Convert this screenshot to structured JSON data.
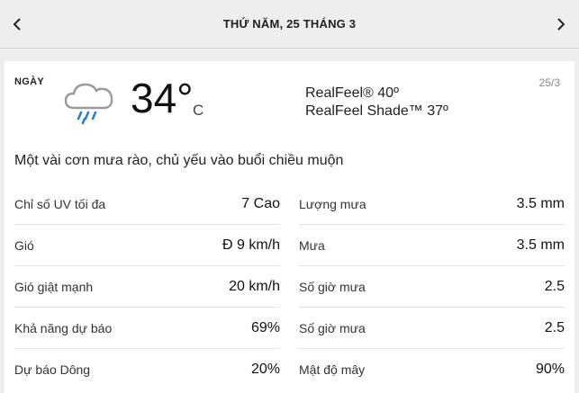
{
  "header": {
    "title": "THỨ NĂM, 25 THÁNG 3",
    "prev_icon": "chevron-left-icon",
    "next_icon": "chevron-right-icon"
  },
  "card": {
    "day_label": "NGÀY",
    "date": "25/3",
    "weather_icon": "cloud-rain-icon",
    "temperature": "34°",
    "unit": "C",
    "realfeel": "RealFeel® 40º",
    "realfeel_shade": "RealFeel Shade™ 37º",
    "phrase": "Một vài cơn mưa rào, chủ yếu vào buổi chiều muộn"
  },
  "details_left": [
    {
      "label": "Chỉ số UV tối đa",
      "value": "7 Cao"
    },
    {
      "label": "Gió",
      "value": "Đ 9 km/h"
    },
    {
      "label": "Gió giật mạnh",
      "value": "20 km/h"
    },
    {
      "label": "Khả năng dự báo",
      "value": "69%"
    },
    {
      "label": "Dự báo Dông",
      "value": "20%"
    }
  ],
  "details_right": [
    {
      "label": "Lượng mưa",
      "value": "3.5 mm"
    },
    {
      "label": "Mưa",
      "value": "3.5 mm"
    },
    {
      "label": "Số giờ mưa",
      "value": "2.5"
    },
    {
      "label": "Số giờ mưa",
      "value": "2.5"
    },
    {
      "label": "Mật độ mây",
      "value": "90%"
    }
  ],
  "colors": {
    "background": "#eeeeee",
    "card": "#ffffff",
    "rain_drops": "#2f7fd0",
    "cloud_outline": "#9a9a9a"
  }
}
